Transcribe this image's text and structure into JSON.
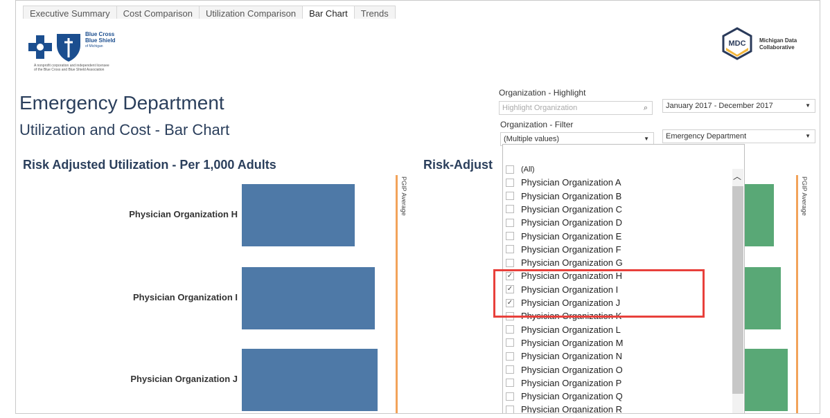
{
  "tabs": [
    {
      "label": "Executive Summary",
      "active": false
    },
    {
      "label": "Cost Comparison",
      "active": false
    },
    {
      "label": "Utilization Comparison",
      "active": false
    },
    {
      "label": "Bar Chart",
      "active": true
    },
    {
      "label": "Trends",
      "active": false
    }
  ],
  "bcbs": {
    "name_line1": "Blue Cross",
    "name_line2": "Blue Shield",
    "name_line3": "of Michigan",
    "tagline_1": "A nonprofit corporation and independent licensee",
    "tagline_2": "of the Blue Cross and Blue Shield Association",
    "color": "#1b4e8f"
  },
  "mdc": {
    "mark": "MDC",
    "name_line1": "Michigan Data",
    "name_line2": "Collaborative"
  },
  "header": {
    "title": "Emergency Department",
    "subtitle": "Utilization and Cost - Bar Chart"
  },
  "controls": {
    "highlight_label": "Organization - Highlight",
    "highlight_placeholder": "Highlight Organization",
    "date_range": "January 2017 - December 2017",
    "filter_label": "Organization - Filter",
    "filter_value": "(Multiple values)",
    "service": "Emergency Department"
  },
  "left_chart": {
    "title": "Risk Adjusted Utilization - Per 1,000 Adults",
    "reference_label": "PGIP Average",
    "bar_color": "#4e79a7",
    "reference_color": "#f2a35a",
    "categories": [
      "Physician Organization H",
      "Physician Organization I",
      "Physician Organization J"
    ],
    "values_fraction_of_reference": [
      0.73,
      0.86,
      0.88
    ]
  },
  "right_chart": {
    "title": "Risk-Adjust",
    "reference_label": "PGIP Average",
    "bar_color": "#59a876",
    "values_fraction_of_reference": [
      0.52,
      0.62,
      0.64
    ]
  },
  "dropdown": {
    "items": [
      {
        "label": "(All)",
        "checked": false
      },
      {
        "label": "Physician Organization A",
        "checked": false
      },
      {
        "label": "Physician Organization B",
        "checked": false
      },
      {
        "label": "Physician Organization C",
        "checked": false
      },
      {
        "label": "Physician Organization D",
        "checked": false
      },
      {
        "label": "Physician Organization E",
        "checked": false
      },
      {
        "label": "Physician Organization F",
        "checked": false
      },
      {
        "label": "Physician Organization G",
        "checked": false
      },
      {
        "label": "Physician Organization H",
        "checked": true
      },
      {
        "label": "Physician Organization I",
        "checked": true
      },
      {
        "label": "Physician Organization J",
        "checked": true
      },
      {
        "label": "Physician Organization K",
        "checked": false
      },
      {
        "label": "Physician Organization L",
        "checked": false
      },
      {
        "label": "Physician Organization M",
        "checked": false
      },
      {
        "label": "Physician Organization N",
        "checked": false
      },
      {
        "label": "Physician Organization O",
        "checked": false
      },
      {
        "label": "Physician Organization P",
        "checked": false
      },
      {
        "label": "Physician Organization Q",
        "checked": false
      },
      {
        "label": "Physician Organization R",
        "checked": false
      }
    ]
  },
  "highlight_color": "#e8403b"
}
